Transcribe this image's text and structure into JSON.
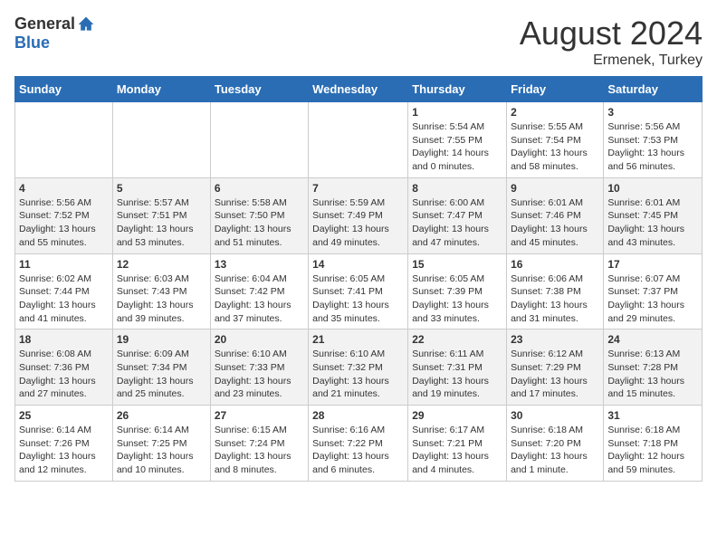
{
  "header": {
    "logo_general": "General",
    "logo_blue": "Blue",
    "month_year": "August 2024",
    "location": "Ermenek, Turkey"
  },
  "weekdays": [
    "Sunday",
    "Monday",
    "Tuesday",
    "Wednesday",
    "Thursday",
    "Friday",
    "Saturday"
  ],
  "weeks": [
    [
      {
        "day": "",
        "info": ""
      },
      {
        "day": "",
        "info": ""
      },
      {
        "day": "",
        "info": ""
      },
      {
        "day": "",
        "info": ""
      },
      {
        "day": "1",
        "info": "Sunrise: 5:54 AM\nSunset: 7:55 PM\nDaylight: 14 hours\nand 0 minutes."
      },
      {
        "day": "2",
        "info": "Sunrise: 5:55 AM\nSunset: 7:54 PM\nDaylight: 13 hours\nand 58 minutes."
      },
      {
        "day": "3",
        "info": "Sunrise: 5:56 AM\nSunset: 7:53 PM\nDaylight: 13 hours\nand 56 minutes."
      }
    ],
    [
      {
        "day": "4",
        "info": "Sunrise: 5:56 AM\nSunset: 7:52 PM\nDaylight: 13 hours\nand 55 minutes."
      },
      {
        "day": "5",
        "info": "Sunrise: 5:57 AM\nSunset: 7:51 PM\nDaylight: 13 hours\nand 53 minutes."
      },
      {
        "day": "6",
        "info": "Sunrise: 5:58 AM\nSunset: 7:50 PM\nDaylight: 13 hours\nand 51 minutes."
      },
      {
        "day": "7",
        "info": "Sunrise: 5:59 AM\nSunset: 7:49 PM\nDaylight: 13 hours\nand 49 minutes."
      },
      {
        "day": "8",
        "info": "Sunrise: 6:00 AM\nSunset: 7:47 PM\nDaylight: 13 hours\nand 47 minutes."
      },
      {
        "day": "9",
        "info": "Sunrise: 6:01 AM\nSunset: 7:46 PM\nDaylight: 13 hours\nand 45 minutes."
      },
      {
        "day": "10",
        "info": "Sunrise: 6:01 AM\nSunset: 7:45 PM\nDaylight: 13 hours\nand 43 minutes."
      }
    ],
    [
      {
        "day": "11",
        "info": "Sunrise: 6:02 AM\nSunset: 7:44 PM\nDaylight: 13 hours\nand 41 minutes."
      },
      {
        "day": "12",
        "info": "Sunrise: 6:03 AM\nSunset: 7:43 PM\nDaylight: 13 hours\nand 39 minutes."
      },
      {
        "day": "13",
        "info": "Sunrise: 6:04 AM\nSunset: 7:42 PM\nDaylight: 13 hours\nand 37 minutes."
      },
      {
        "day": "14",
        "info": "Sunrise: 6:05 AM\nSunset: 7:41 PM\nDaylight: 13 hours\nand 35 minutes."
      },
      {
        "day": "15",
        "info": "Sunrise: 6:05 AM\nSunset: 7:39 PM\nDaylight: 13 hours\nand 33 minutes."
      },
      {
        "day": "16",
        "info": "Sunrise: 6:06 AM\nSunset: 7:38 PM\nDaylight: 13 hours\nand 31 minutes."
      },
      {
        "day": "17",
        "info": "Sunrise: 6:07 AM\nSunset: 7:37 PM\nDaylight: 13 hours\nand 29 minutes."
      }
    ],
    [
      {
        "day": "18",
        "info": "Sunrise: 6:08 AM\nSunset: 7:36 PM\nDaylight: 13 hours\nand 27 minutes."
      },
      {
        "day": "19",
        "info": "Sunrise: 6:09 AM\nSunset: 7:34 PM\nDaylight: 13 hours\nand 25 minutes."
      },
      {
        "day": "20",
        "info": "Sunrise: 6:10 AM\nSunset: 7:33 PM\nDaylight: 13 hours\nand 23 minutes."
      },
      {
        "day": "21",
        "info": "Sunrise: 6:10 AM\nSunset: 7:32 PM\nDaylight: 13 hours\nand 21 minutes."
      },
      {
        "day": "22",
        "info": "Sunrise: 6:11 AM\nSunset: 7:31 PM\nDaylight: 13 hours\nand 19 minutes."
      },
      {
        "day": "23",
        "info": "Sunrise: 6:12 AM\nSunset: 7:29 PM\nDaylight: 13 hours\nand 17 minutes."
      },
      {
        "day": "24",
        "info": "Sunrise: 6:13 AM\nSunset: 7:28 PM\nDaylight: 13 hours\nand 15 minutes."
      }
    ],
    [
      {
        "day": "25",
        "info": "Sunrise: 6:14 AM\nSunset: 7:26 PM\nDaylight: 13 hours\nand 12 minutes."
      },
      {
        "day": "26",
        "info": "Sunrise: 6:14 AM\nSunset: 7:25 PM\nDaylight: 13 hours\nand 10 minutes."
      },
      {
        "day": "27",
        "info": "Sunrise: 6:15 AM\nSunset: 7:24 PM\nDaylight: 13 hours\nand 8 minutes."
      },
      {
        "day": "28",
        "info": "Sunrise: 6:16 AM\nSunset: 7:22 PM\nDaylight: 13 hours\nand 6 minutes."
      },
      {
        "day": "29",
        "info": "Sunrise: 6:17 AM\nSunset: 7:21 PM\nDaylight: 13 hours\nand 4 minutes."
      },
      {
        "day": "30",
        "info": "Sunrise: 6:18 AM\nSunset: 7:20 PM\nDaylight: 13 hours\nand 1 minute."
      },
      {
        "day": "31",
        "info": "Sunrise: 6:18 AM\nSunset: 7:18 PM\nDaylight: 12 hours\nand 59 minutes."
      }
    ]
  ]
}
